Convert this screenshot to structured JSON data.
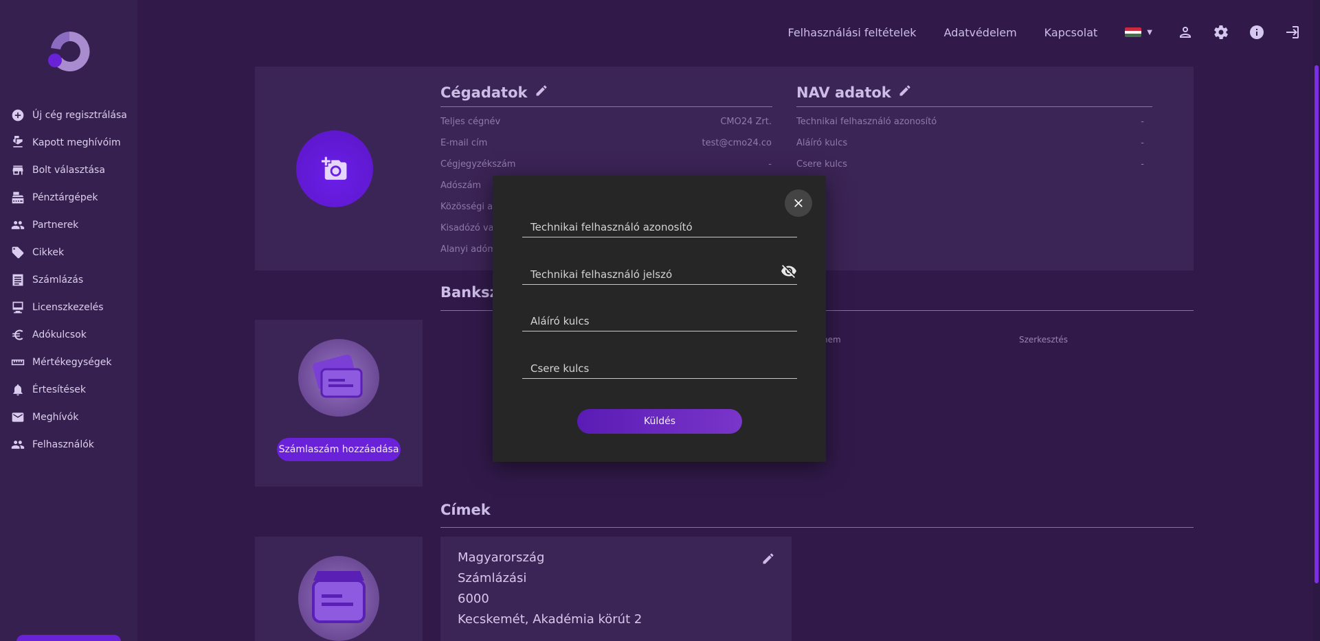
{
  "sidebar": {
    "items": [
      {
        "label": "Új cég regisztrálása",
        "icon": "add-circle-icon"
      },
      {
        "label": "Kapott meghívóim",
        "icon": "mail-open-icon"
      },
      {
        "label": "Bolt választása",
        "icon": "store-icon"
      },
      {
        "label": "Pénztárgépek",
        "icon": "cash-register-icon"
      },
      {
        "label": "Partnerek",
        "icon": "people-icon"
      },
      {
        "label": "Cikkek",
        "icon": "tag-icon"
      },
      {
        "label": "Számlázás",
        "icon": "receipt-icon"
      },
      {
        "label": "Licenszkezelés",
        "icon": "monitor-icon"
      },
      {
        "label": "Adókulcsok",
        "icon": "euro-icon"
      },
      {
        "label": "Mértékegységek",
        "icon": "ruler-icon"
      },
      {
        "label": "Értesítések",
        "icon": "bell-icon"
      },
      {
        "label": "Meghívók",
        "icon": "mail-icon"
      },
      {
        "label": "Felhasználók",
        "icon": "people-icon"
      }
    ]
  },
  "header": {
    "links": [
      "Felhasználási feltételek",
      "Adatvédelem",
      "Kapcsolat"
    ],
    "flag_colors": [
      "#cd2a3e",
      "#ffffff",
      "#436f4d"
    ]
  },
  "company": {
    "title": "Cégadatok",
    "rows": [
      {
        "label": "Teljes cégnév",
        "value": "CMO24 Zrt."
      },
      {
        "label": "E-mail cím",
        "value": "test@cmo24.co"
      },
      {
        "label": "Cégjegyzékszám",
        "value": "-"
      },
      {
        "label": "Adószám",
        "value": ""
      },
      {
        "label": "Közösségi ad",
        "value": ""
      },
      {
        "label": "Kisadózó vag",
        "value": ""
      },
      {
        "label": "Alanyi adóm",
        "value": ""
      }
    ]
  },
  "nav_data": {
    "title": "NAV adatok",
    "rows": [
      {
        "label": "Technikai felhasználó azonosító",
        "value": "-"
      },
      {
        "label": "Aláíró kulcs",
        "value": "-"
      },
      {
        "label": "Csere kulcs",
        "value": "-"
      }
    ]
  },
  "bank": {
    "title": "Banksz",
    "col_partial": "nem",
    "col_edit": "Szerkesztés",
    "add_label": "Számlaszám hozzáadása"
  },
  "addresses": {
    "title": "Címek",
    "lines": [
      "Magyarország",
      "Számlázási",
      "6000",
      "Kecskemét, Akadémia körút 2"
    ]
  },
  "modal": {
    "fields": [
      {
        "placeholder": "Technikai felhasználó azonosító"
      },
      {
        "placeholder": "Technikai felhasználó jelszó"
      },
      {
        "placeholder": "Aláíró kulcs"
      },
      {
        "placeholder": "Csere kulcs"
      }
    ],
    "submit_label": "Küldés"
  },
  "colors": {
    "background": "#311a4a",
    "accent": "#6a22d8",
    "modal_bg": "#262626"
  }
}
